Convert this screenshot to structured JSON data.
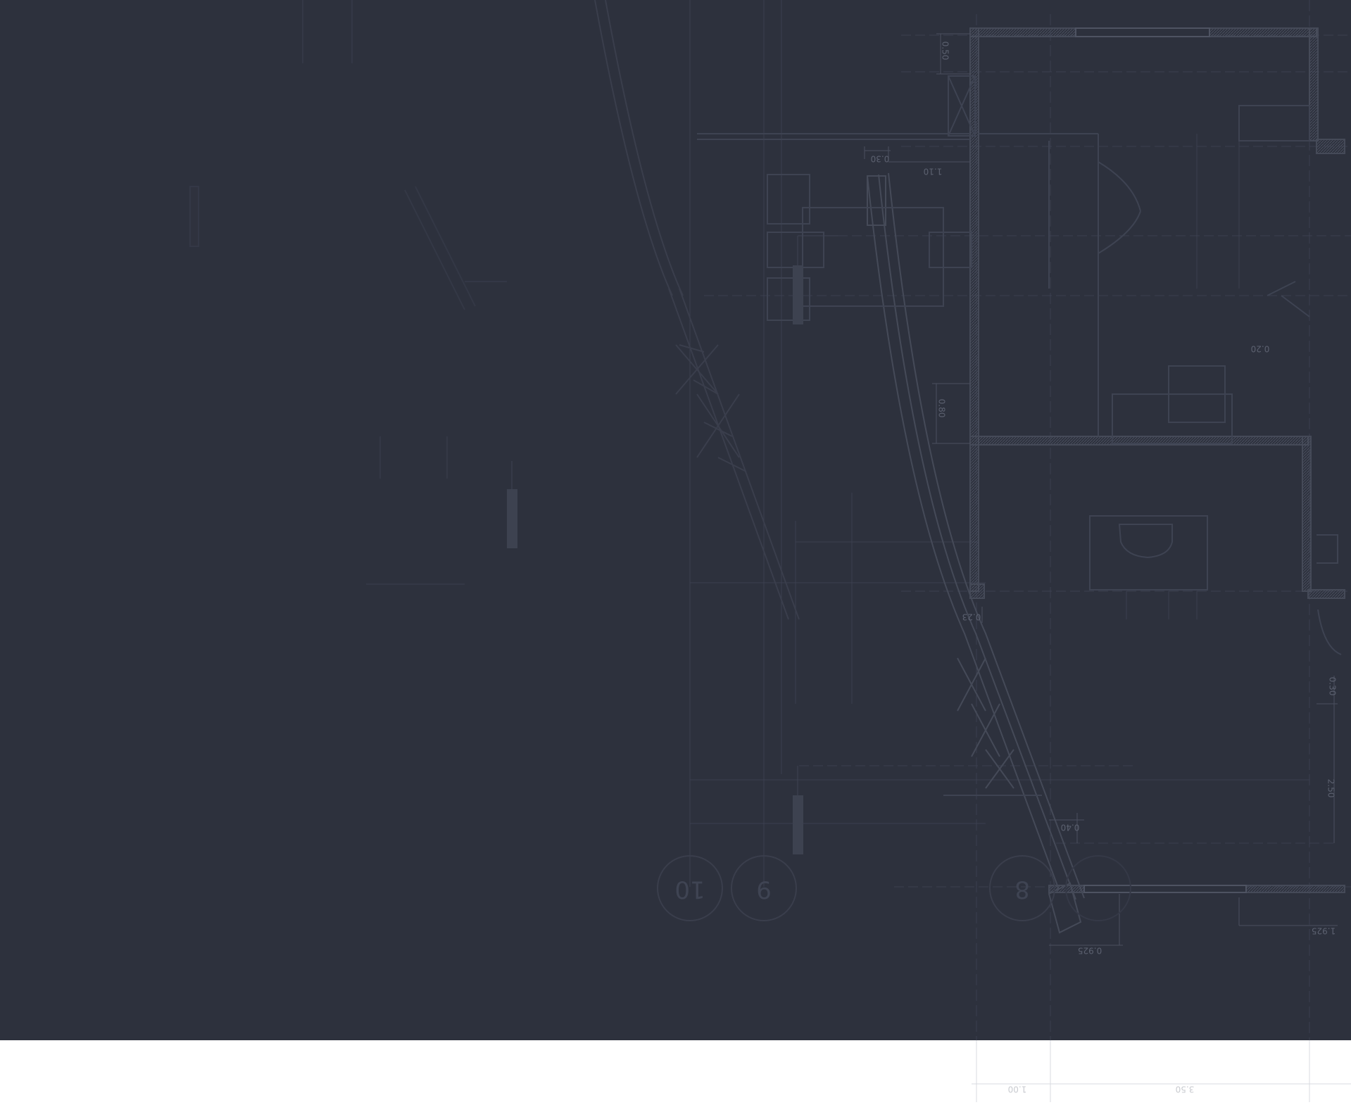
{
  "colors": {
    "background": "#2d313d",
    "page_bottom": "#ffffff",
    "line": "#3e4352",
    "line_light": "#4a4f5e",
    "wall_fill": "#3a3f4c",
    "hatch": "#454a58",
    "text": "#5c6170",
    "text_bottom": "#c9cbd0",
    "marker_fill": "#3d4250"
  },
  "dimension_labels": [
    {
      "id": "dim-050",
      "text": "0.50"
    },
    {
      "id": "dim-030-top",
      "text": "0.30"
    },
    {
      "id": "dim-110",
      "text": "1.10"
    },
    {
      "id": "dim-080",
      "text": "0.80"
    },
    {
      "id": "dim-020",
      "text": "0.20"
    },
    {
      "id": "dim-023",
      "text": "0.23"
    },
    {
      "id": "dim-030-right",
      "text": "0.30"
    },
    {
      "id": "dim-250",
      "text": "2.50"
    },
    {
      "id": "dim-040",
      "text": "0.40"
    },
    {
      "id": "dim-0925",
      "text": "0.925"
    },
    {
      "id": "dim-1925",
      "text": "1.925"
    },
    {
      "id": "dim-100-bottom",
      "text": "1.00"
    },
    {
      "id": "dim-350-bottom",
      "text": "3.50"
    }
  ],
  "grid_markers": [
    {
      "id": "grid-10",
      "label": "10"
    },
    {
      "id": "grid-9",
      "label": "9"
    },
    {
      "id": "grid-8",
      "label": "8"
    }
  ]
}
